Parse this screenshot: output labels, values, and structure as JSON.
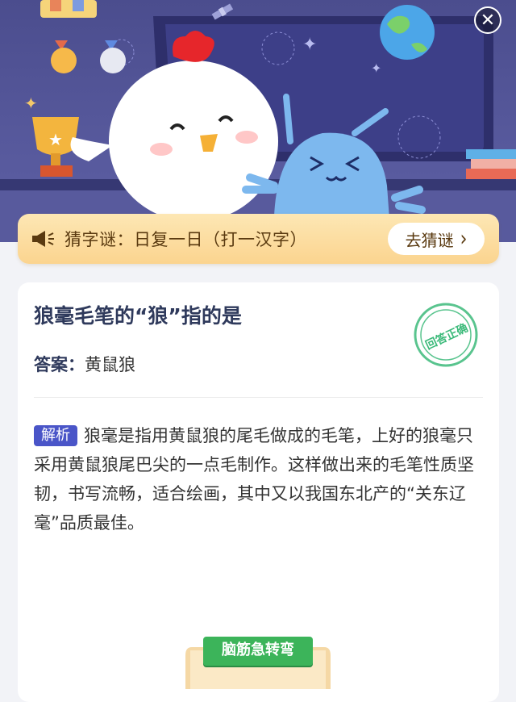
{
  "hero": {
    "close_icon": "close-icon"
  },
  "riddle": {
    "icon": "speaker-icon",
    "text": "猜字谜：日复一日（打一汉字）",
    "button_label": "去猜谜",
    "button_icon": "chevron-right-icon"
  },
  "card": {
    "question": "狼毫毛笔的“狼”指的是",
    "answer_label": "答案：",
    "answer_value": "黄鼠狼",
    "stamp_text": "回答正确",
    "explain_tag": "解析",
    "explain_text": "狼毫是指用黄鼠狼的尾毛做成的毛笔，上好的狼毫只采用黄鼠狼尾巴尖的一点毛制作。这样做出来的毛笔性质坚韧，书写流畅，适合绘画，其中又以我国东北产的“关东辽毫”品质最佳。"
  },
  "footer": {
    "scroll_label": "脑筋急转弯"
  },
  "colors": {
    "hero_bg": "#4b4d8e",
    "riddle_bg": "#fbd48f",
    "tag_bg": "#4a55c8",
    "stamp_green": "#3cba7a",
    "scroll_green": "#3cb45a"
  }
}
